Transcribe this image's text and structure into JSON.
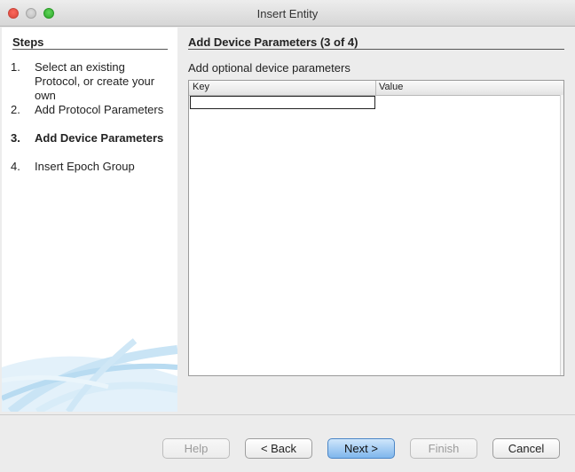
{
  "window": {
    "title": "Insert Entity"
  },
  "steps": {
    "heading": "Steps",
    "items": [
      {
        "num": "1.",
        "label": "Select an existing Protocol, or create your own"
      },
      {
        "num": "2.",
        "label": "Add Protocol Parameters"
      },
      {
        "num": "3.",
        "label": "Add Device Parameters"
      },
      {
        "num": "4.",
        "label": "Insert Epoch Group"
      }
    ],
    "current_index": 2
  },
  "main": {
    "title": "Add Device Parameters (3 of 4)",
    "subtitle": "Add optional device parameters",
    "table": {
      "columns": [
        "Key",
        "Value"
      ],
      "rows": [
        {
          "key": "",
          "value": ""
        }
      ]
    }
  },
  "buttons": {
    "help": "Help",
    "back": "< Back",
    "next": "Next >",
    "finish": "Finish",
    "cancel": "Cancel"
  },
  "colors": {
    "primary_button": "#7fb6ec",
    "close": "#fc6a5d",
    "minimize": "#c8c8c8",
    "zoom": "#3dbb36"
  }
}
